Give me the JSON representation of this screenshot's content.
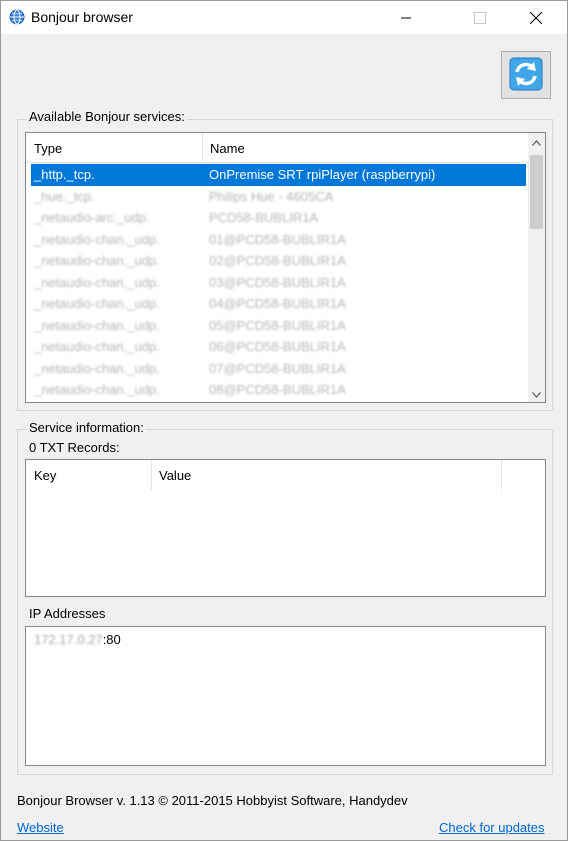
{
  "window": {
    "title": "Bonjour browser"
  },
  "services": {
    "group_label": "Available Bonjour services:",
    "columns": [
      "Type",
      "Name"
    ],
    "rows": [
      {
        "type": "_http._tcp.",
        "name": "OnPremise SRT rpiPlayer (raspberrypi)",
        "selected": true
      },
      {
        "type": "_hue._tcp.",
        "name": "Philips Hue - 4605CA",
        "selected": false
      },
      {
        "type": "_netaudio-arc._udp.",
        "name": "PCD58-BUBLIR1A",
        "selected": false
      },
      {
        "type": "_netaudio-chan._udp.",
        "name": "01@PCD58-BUBLIR1A",
        "selected": false
      },
      {
        "type": "_netaudio-chan._udp.",
        "name": "02@PCD58-BUBLIR1A",
        "selected": false
      },
      {
        "type": "_netaudio-chan._udp.",
        "name": "03@PCD58-BUBLIR1A",
        "selected": false
      },
      {
        "type": "_netaudio-chan._udp.",
        "name": "04@PCD58-BUBLIR1A",
        "selected": false
      },
      {
        "type": "_netaudio-chan._udp.",
        "name": "05@PCD58-BUBLIR1A",
        "selected": false
      },
      {
        "type": "_netaudio-chan._udp.",
        "name": "06@PCD58-BUBLIR1A",
        "selected": false
      },
      {
        "type": "_netaudio-chan._udp.",
        "name": "07@PCD58-BUBLIR1A",
        "selected": false
      },
      {
        "type": "_netaudio-chan._udp.",
        "name": "08@PCD58-BUBLIR1A",
        "selected": false
      }
    ]
  },
  "service_info": {
    "group_label": "Service information:",
    "txt_label": "0 TXT Records:",
    "txt_columns": [
      "Key",
      "Value"
    ],
    "ip_label": "IP Addresses",
    "ip_entries": [
      {
        "address_hidden": "172.17.0.27",
        "port_suffix": ":80"
      }
    ]
  },
  "footer": {
    "copyright": "Bonjour Browser v. 1.13 © 2011-2015 Hobbyist Software, Handydev",
    "website_link": "Website",
    "updates_link": "Check for updates"
  },
  "icons": {
    "app": "globe-icon",
    "refresh": "refresh-icon",
    "minimize": "minimize-icon",
    "maximize": "maximize-icon",
    "close": "close-icon"
  },
  "colors": {
    "selection": "#0078d7",
    "link": "#0066cc",
    "window_bg": "#f0f0f0"
  }
}
